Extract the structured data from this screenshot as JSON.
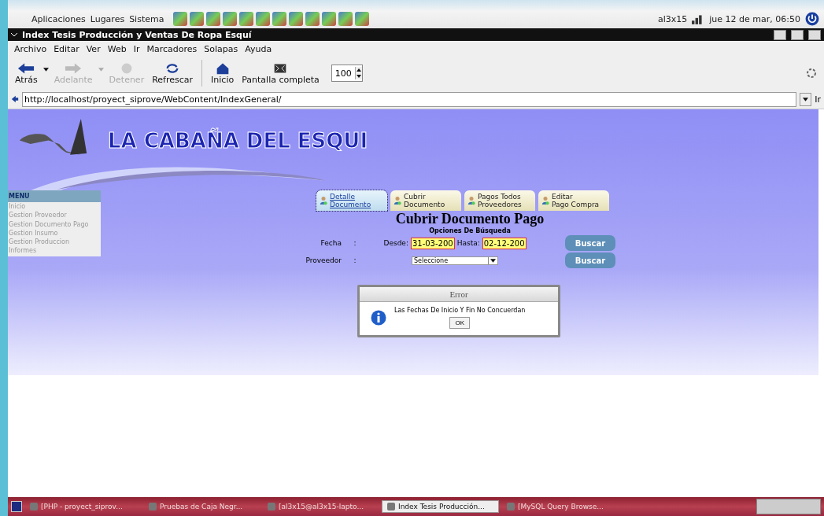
{
  "panel": {
    "menus": [
      "Aplicaciones",
      "Lugares",
      "Sistema"
    ],
    "user": "al3x15",
    "clock": "jue 12 de mar, 06:50"
  },
  "window": {
    "title": "Index Tesis Producción y Ventas De Ropa Esquí"
  },
  "menubar": [
    "Archivo",
    "Editar",
    "Ver",
    "Web",
    "Ir",
    "Marcadores",
    "Solapas",
    "Ayuda"
  ],
  "toolbar": {
    "buttons": [
      {
        "label": "Atrás",
        "kind": "back",
        "disabled": false
      },
      {
        "label": "Adelante",
        "kind": "forward",
        "disabled": true
      },
      {
        "label": "Detener",
        "kind": "stop",
        "disabled": true
      },
      {
        "label": "Refrescar",
        "kind": "reload",
        "disabled": false
      },
      {
        "label": "Inicio",
        "kind": "home",
        "disabled": false
      },
      {
        "label": "Pantalla completa",
        "kind": "fullscreen",
        "disabled": false
      }
    ],
    "zoom": "100"
  },
  "address": {
    "url": "http://localhost/proyect_siprove/WebContent/IndexGeneral/",
    "go": "Ir"
  },
  "page": {
    "logo": "LA CABAÑA DEL ESQUI",
    "menu": {
      "title": "MENU",
      "items": [
        "Inicio",
        "Gestion Proveedor",
        "Gestion Documento Pago",
        "Gestion Insumo",
        "Gestion Produccion",
        "Informes"
      ]
    },
    "tabs": [
      {
        "line1": "Detalle",
        "line2": "Documento",
        "selected": true
      },
      {
        "line1": "Cubrir",
        "line2": "Documento",
        "selected": false
      },
      {
        "line1": "Pagos Todos",
        "line2": "Proveedores",
        "selected": false
      },
      {
        "line1": "Editar",
        "line2": "Pago Compra",
        "selected": false
      }
    ],
    "heading": "Cubrir Documento Pago",
    "subheading": "Opciones De Búsqueda",
    "date_row": {
      "label": "Fecha",
      "colon": ":",
      "from_label": "Desde:",
      "from": "31-03-200",
      "to_label": "Hasta:",
      "to": "02-12-200",
      "button": "Buscar"
    },
    "provider_row": {
      "label": "Proveedor",
      "colon": ":",
      "select": "Seleccione",
      "button": "Buscar"
    },
    "dialog": {
      "title": "Error",
      "message": "Las Fechas De Inicio Y Fin No Concuerdan",
      "button": "OK"
    }
  },
  "taskbar": [
    {
      "label": "[PHP - proyect_siprov...",
      "selected": false
    },
    {
      "label": "Pruebas de Caja Negr...",
      "selected": false
    },
    {
      "label": "[al3x15@al3x15-lapto...",
      "selected": false
    },
    {
      "label": "Index Tesis Producción...",
      "selected": true
    },
    {
      "label": "[MySQL Query Browse...",
      "selected": false
    }
  ]
}
